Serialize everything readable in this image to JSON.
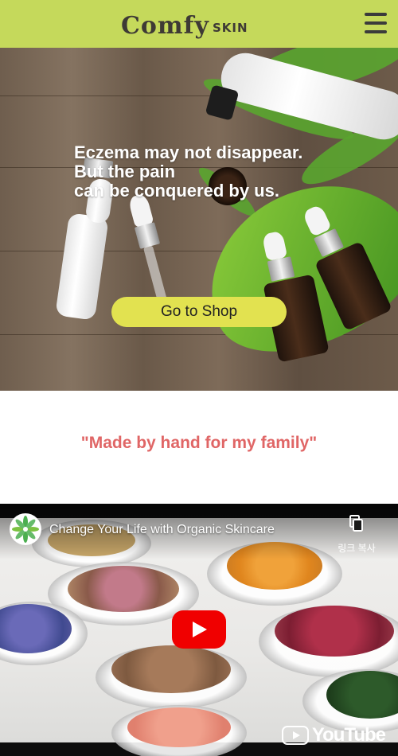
{
  "header": {
    "logo_main": "Comfy",
    "logo_sub": "SKIN",
    "menu_icon": "hamburger-menu-icon",
    "background": "#c5d95b"
  },
  "hero": {
    "lines": [
      "Eczema may not disappear.",
      "But the pain",
      "can be conquered by us."
    ],
    "cta_label": "Go to Shop",
    "cta_color": "#e2e250"
  },
  "quote": {
    "text": "\"Made by hand for my family\"",
    "color": "#e06666"
  },
  "video": {
    "title": "Change Your Life with Organic Skincare",
    "copy_link_label": "링크 복사",
    "copy_icon": "copy-icon",
    "play_icon": "play-icon",
    "brand": "YouTube",
    "play_color": "#f00000"
  }
}
